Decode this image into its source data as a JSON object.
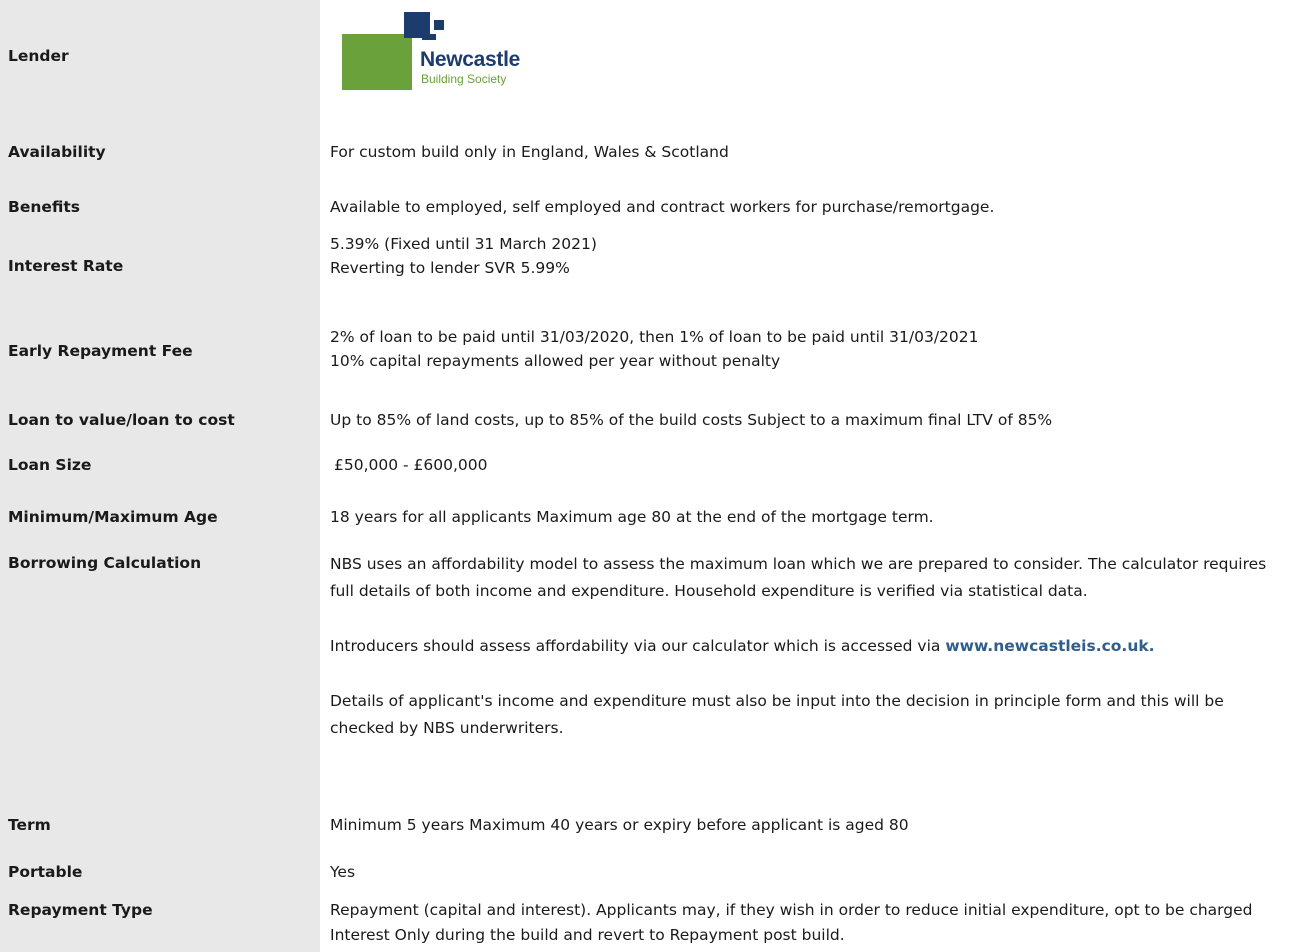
{
  "rows": {
    "lender": {
      "label": "Lender",
      "logo_name": "Newcastle",
      "logo_sub": "Building Society"
    },
    "availability": {
      "label": "Availability",
      "value": "For custom build only in England, Wales & Scotland"
    },
    "benefits": {
      "label": "Benefits",
      "value": "Available to employed, self employed and contract workers for purchase/remortgage."
    },
    "interest_rate": {
      "label": "Interest Rate",
      "line1": "5.39% (Fixed until 31 March 2021)",
      "line2": "Reverting to lender SVR 5.99%"
    },
    "early_repayment": {
      "label": "Early Repayment Fee",
      "line1": "2% of loan to be paid until 31/03/2020, then 1% of loan to be paid until 31/03/2021",
      "line2": "10% capital repayments allowed per year without penalty"
    },
    "ltv": {
      "label": "Loan to value/loan to cost",
      "value": "Up to 85% of land costs, up to 85% of the build costs Subject to a maximum final LTV of 85%"
    },
    "loan_size": {
      "label": "Loan Size",
      "value": "£50,000 - £600,000"
    },
    "age": {
      "label": "Minimum/Maximum Age",
      "value": "18 years for all applicants Maximum age 80 at the end of the mortgage term."
    },
    "borrowing": {
      "label": "Borrowing Calculation",
      "para1": "NBS uses an affordability model to assess the maximum loan which we are prepared to consider. The calculator requires full details of both income and expenditure. Household expenditure is verified via statistical data.",
      "para2_prefix": "Introducers should assess affordability via our calculator which is accessed via ",
      "para2_link": "www.newcastleis.co.uk.",
      "para3": "Details of applicant's income and expenditure must also be input into the decision in principle form and this will be checked by NBS underwriters."
    },
    "term": {
      "label": "Term",
      "value": "Minimum 5 years Maximum 40 years or expiry before applicant is aged 80"
    },
    "portable": {
      "label": "Portable",
      "value": "Yes"
    },
    "repayment_type": {
      "label": "Repayment Type",
      "value": "Repayment (capital and interest). Applicants may, if they wish in order to reduce initial expenditure, opt to be charged Interest Only during the build and revert to Repayment post build."
    }
  }
}
